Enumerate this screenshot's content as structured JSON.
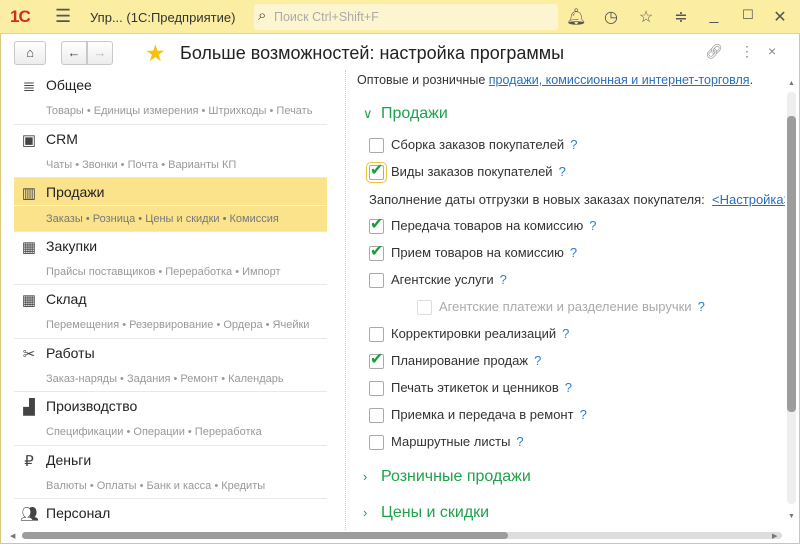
{
  "titlebar": {
    "logo": "1С",
    "app_title": "Упр...  (1С:Предприятие)",
    "search_placeholder": "Поиск Ctrl+Shift+F"
  },
  "page": {
    "title": "Больше возможностей: настройка программы"
  },
  "sidebar": {
    "items": [
      {
        "title": "Общее",
        "sub": "Товары • Единицы измерения • Штрихкоды • Печать",
        "icon": "list-icon"
      },
      {
        "title": "CRM",
        "sub": "Чаты • Звонки • Почта • Варианты КП",
        "icon": "crm-icon"
      },
      {
        "title": "Продажи",
        "sub": "Заказы • Розница • Цены и скидки • Комиссия",
        "icon": "basket-icon",
        "selected": true
      },
      {
        "title": "Закупки",
        "sub": "Прайсы поставщиков • Переработка • Импорт",
        "icon": "cart-icon"
      },
      {
        "title": "Склад",
        "sub": "Перемещения • Резервирование • Ордера • Ячейки",
        "icon": "warehouse-icon"
      },
      {
        "title": "Работы",
        "sub": "Заказ-наряды • Задания • Ремонт • Календарь",
        "icon": "tools-icon"
      },
      {
        "title": "Производство",
        "sub": "Спецификации • Операции • Переработка",
        "icon": "factory-icon"
      },
      {
        "title": "Деньги",
        "sub": "Валюты • Оплаты • Банк и касса • Кредиты",
        "icon": "ruble-icon"
      },
      {
        "title": "Персонал",
        "sub": "",
        "icon": "people-icon"
      }
    ]
  },
  "content": {
    "intro_text": "Оптовые и розничные ",
    "intro_link": "продажи, комиссионная и интернет-торговля",
    "intro_end": ".",
    "group_sales": "Продажи",
    "help": "?",
    "options": [
      {
        "label": "Сборка заказов покупателей",
        "checked": false
      },
      {
        "label": "Виды заказов покупателей",
        "checked": true
      },
      {
        "label": "Передача товаров на комиссию",
        "checked": true
      },
      {
        "label": "Прием товаров на комиссию",
        "checked": true
      },
      {
        "label": "Агентские услуги",
        "checked": false
      },
      {
        "label": "Агентские платежи и разделение выручки",
        "checked": false,
        "disabled": true
      },
      {
        "label": "Корректировки реализаций",
        "checked": false
      },
      {
        "label": "Планирование продаж",
        "checked": true
      },
      {
        "label": "Печать этикеток и ценников",
        "checked": false
      },
      {
        "label": "Приемка и передача в ремонт",
        "checked": false
      },
      {
        "label": "Маршрутные листы",
        "checked": false
      }
    ],
    "fill_date_label": "Заполнение даты отгрузки в новых заказах покупателя:",
    "fill_date_link": "<Настройка>",
    "group_retail": "Розничные продажи",
    "group_prices": "Цены и скидки"
  },
  "colors": {
    "accent": "#fbe38c",
    "group": "#1fa24b",
    "link": "#2a6ebb"
  }
}
